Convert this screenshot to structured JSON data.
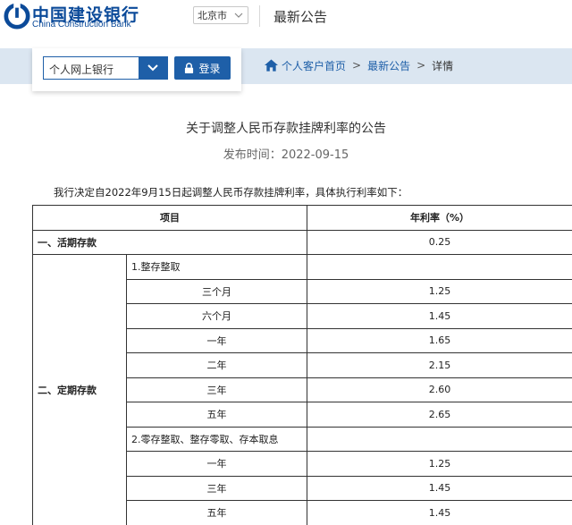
{
  "header": {
    "logo_cn": "中国建设银行",
    "logo_en": "China Construction Bank",
    "city": "北京市",
    "page_heading": "最新公告"
  },
  "nav": {
    "bank_select": "个人网上银行",
    "login_label": "登录",
    "breadcrumb": {
      "home": "个人客户首页",
      "sep": ">",
      "announcements": "最新公告",
      "current": "详情"
    }
  },
  "article": {
    "title": "关于调整人民币存款挂牌利率的公告",
    "publish_line": "发布时间：2022-09-15",
    "intro": "我行决定自2022年9月15日起调整人民币存款挂牌利率，具体执行利率如下："
  },
  "table": {
    "header_item": "项目",
    "header_rate": "年利率（%）",
    "demand_label": "一、活期存款",
    "demand_rate": "0.25",
    "time_label": "二、定期存款",
    "group1_label": "1.整存整取",
    "group1_rows": [
      {
        "term": "三个月",
        "rate": "1.25"
      },
      {
        "term": "六个月",
        "rate": "1.45"
      },
      {
        "term": "一年",
        "rate": "1.65"
      },
      {
        "term": "二年",
        "rate": "2.15"
      },
      {
        "term": "三年",
        "rate": "2.60"
      },
      {
        "term": "五年",
        "rate": "2.65"
      }
    ],
    "group2_label": "2.零存整取、整存零取、存本取息",
    "group2_rows": [
      {
        "term": "一年",
        "rate": "1.25"
      },
      {
        "term": "三年",
        "rate": "1.45"
      },
      {
        "term": "五年",
        "rate": "1.45"
      }
    ]
  },
  "colors": {
    "brand_blue": "#1e5fa8",
    "nav_bg": "#dbe6f1"
  },
  "icons": [
    "ccb-logo-icon",
    "chevron-down-icon",
    "lock-icon",
    "home-icon"
  ]
}
